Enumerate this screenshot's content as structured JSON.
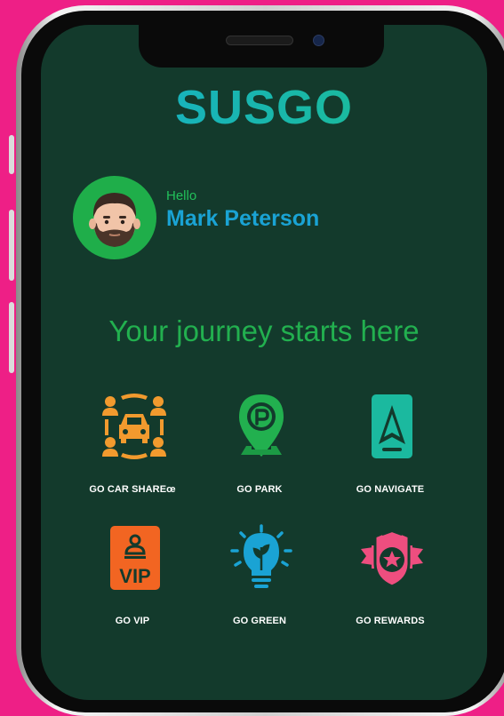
{
  "app": {
    "brand": "SUSGO"
  },
  "user": {
    "greeting": "Hello",
    "name": "Mark Peterson"
  },
  "tagline": "Your journey starts here",
  "menu": [
    {
      "label": "GO CAR SHAREœ",
      "icon": "car-share-icon",
      "color": "#f29a2e"
    },
    {
      "label": "GO PARK",
      "icon": "parking-pin-icon",
      "color": "#22b04f"
    },
    {
      "label": "GO NAVIGATE",
      "icon": "navigate-icon",
      "color": "#1bb99f"
    },
    {
      "label": "GO VIP",
      "icon": "vip-badge-icon",
      "color": "#f26522"
    },
    {
      "label": "GO GREEN",
      "icon": "green-bulb-icon",
      "color": "#1aa3d4"
    },
    {
      "label": "GO REWARDS",
      "icon": "rewards-badge-icon",
      "color": "#ee4e7f"
    }
  ],
  "colors": {
    "background": "#ee1f86",
    "screen": "#133a2c",
    "accent_green": "#22b04f",
    "accent_blue": "#1aa3d4"
  }
}
